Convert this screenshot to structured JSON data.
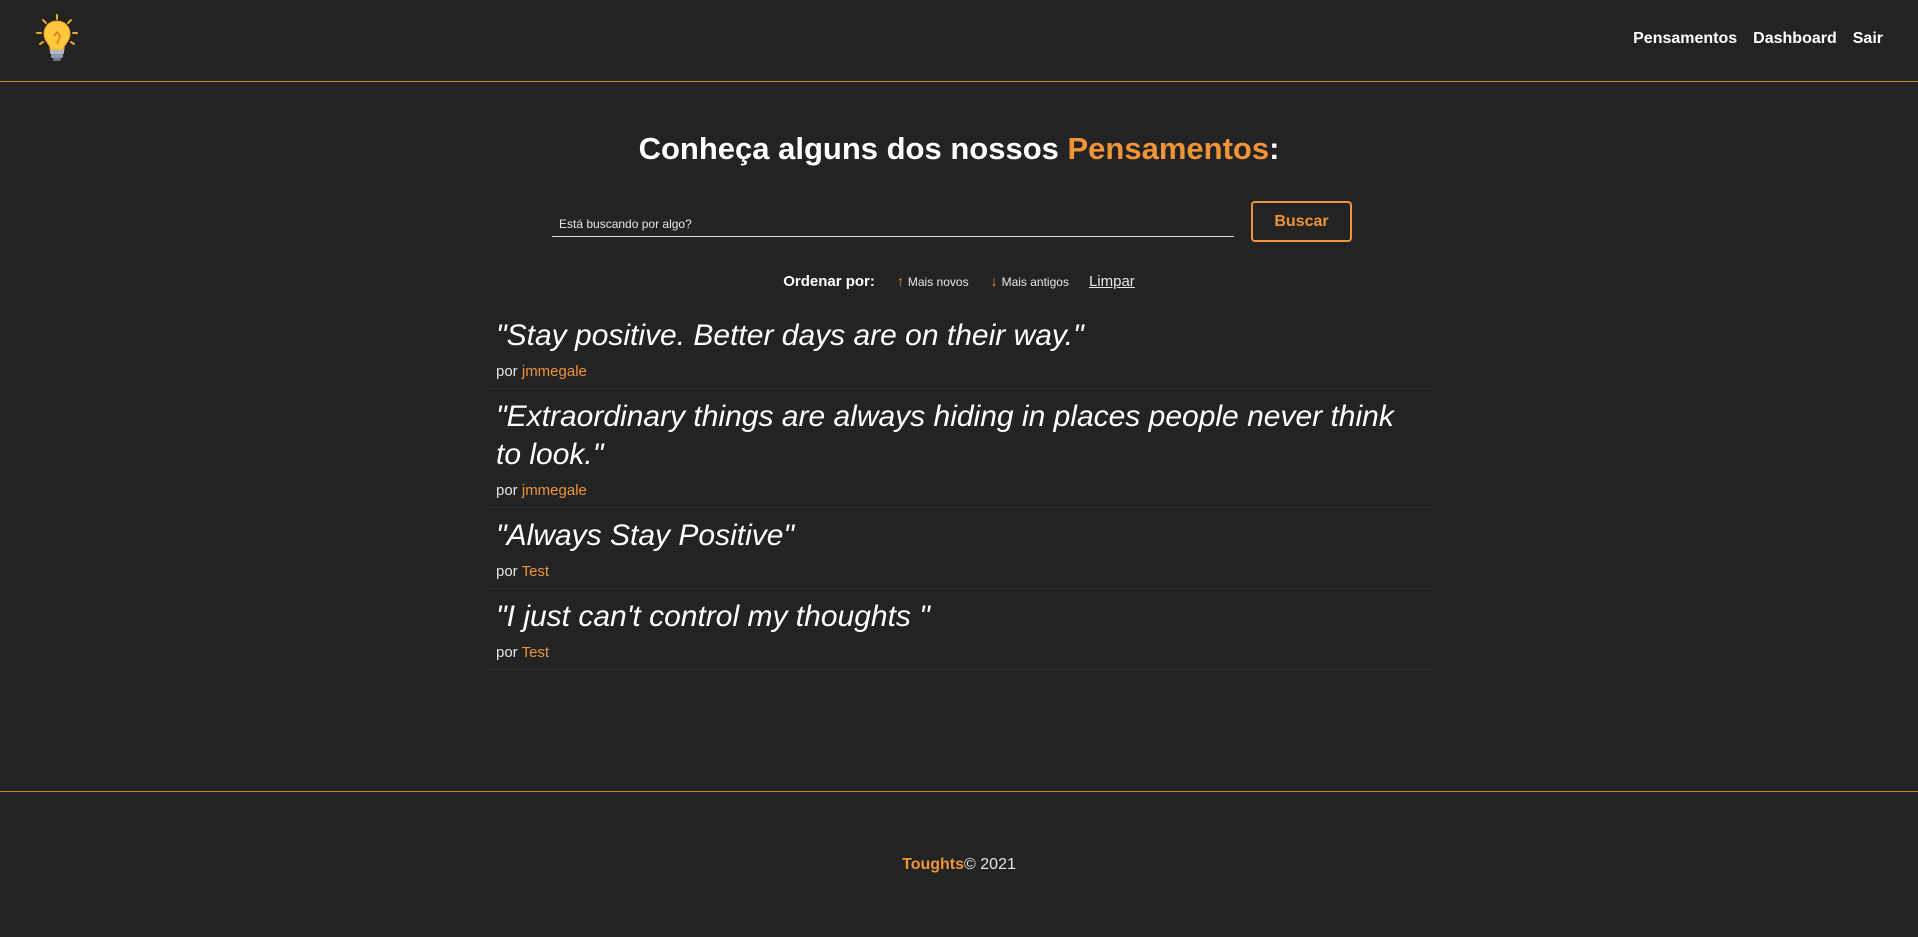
{
  "nav": {
    "logo_icon": "lightbulb-icon",
    "links": [
      "Pensamentos",
      "Dashboard",
      "Sair"
    ]
  },
  "main": {
    "title_prefix": "Conheça alguns dos nossos ",
    "title_accent": "Pensamentos",
    "title_suffix": ":",
    "search": {
      "placeholder": "Está buscando por algo?",
      "value": "",
      "button_label": "Buscar"
    },
    "order": {
      "label": "Ordenar por:",
      "newest": "Mais novos",
      "oldest": "Mais antigos",
      "clear": "Limpar"
    },
    "thoughts": [
      {
        "text": "\"Stay positive. Better days are on their way.\"",
        "by": "por",
        "author": "jmmegale"
      },
      {
        "text": "\"Extraordinary things are always hiding in places people never think to look.\"",
        "by": "por",
        "author": "jmmegale"
      },
      {
        "text": "\"Always Stay Positive\"",
        "by": "por",
        "author": "Test"
      },
      {
        "text": "\"I just can't control my thoughts \"",
        "by": "por",
        "author": "Test"
      }
    ]
  },
  "footer": {
    "brand": "Toughts",
    "copyright": "© 2021"
  },
  "colors": {
    "background": "#232323",
    "accent": "#f0943a",
    "divider": "#c8842b"
  }
}
